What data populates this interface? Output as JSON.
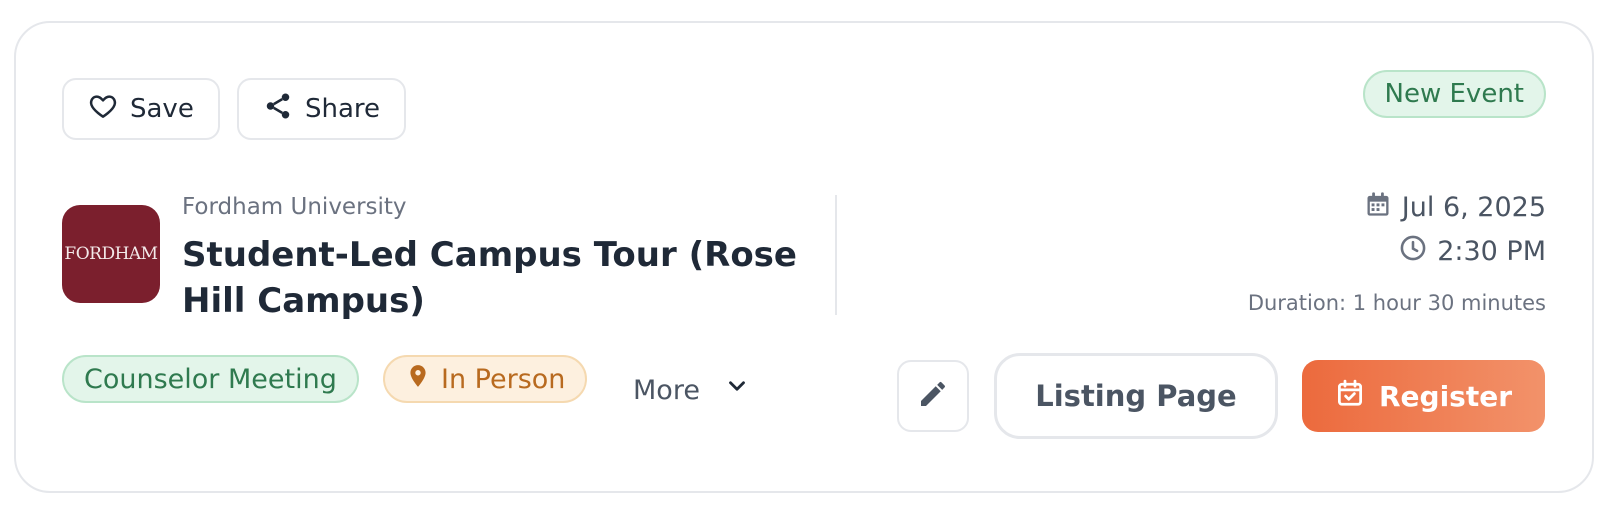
{
  "actions": {
    "save_label": "Save",
    "share_label": "Share"
  },
  "badge": {
    "label": "New Event"
  },
  "event": {
    "organization": "Fordham University",
    "logo_text": "FORDHAM",
    "title": "Student-Led Campus Tour (Rose Hill Campus)",
    "date": "Jul 6, 2025",
    "time": "2:30 PM",
    "duration": "Duration: 1 hour 30 minutes"
  },
  "tags": [
    {
      "label": "Counselor Meeting",
      "color": "#2f7a4f"
    },
    {
      "label": "In Person",
      "color": "#b86a1f",
      "icon": "map-pin-icon"
    }
  ],
  "more_label": "More",
  "buttons": {
    "edit_icon": "pencil-icon",
    "listing_label": "Listing Page",
    "register_label": "Register"
  },
  "colors": {
    "accent": "#ec6a3d",
    "logo_bg": "#7b1f2d",
    "green_text": "#2f7a4f",
    "orange_text": "#b86a1f"
  }
}
